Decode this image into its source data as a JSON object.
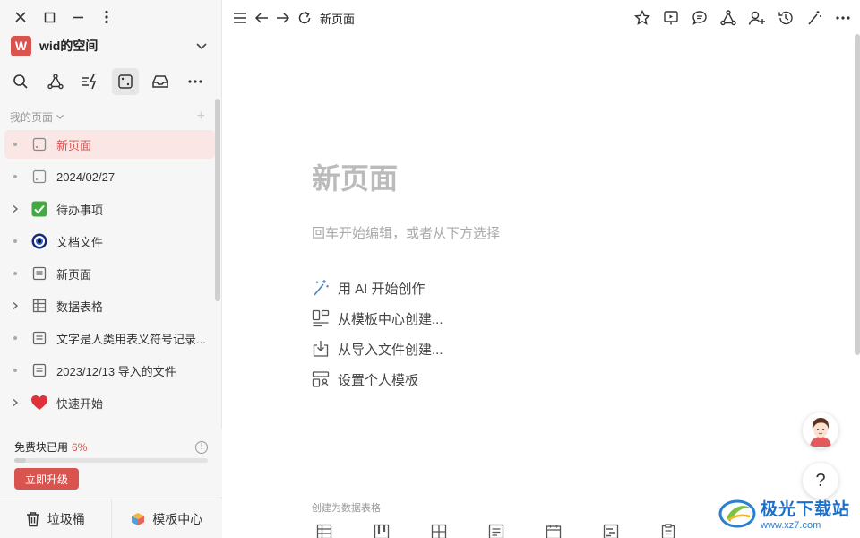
{
  "window": {
    "controls": [
      "close-icon",
      "maximize-icon",
      "minimize-icon",
      "more-vertical-icon"
    ]
  },
  "workspace": {
    "avatar_letter": "W",
    "name": "wid的空间",
    "accent": "#d9534f"
  },
  "toolbar": [
    "search-icon",
    "graph-icon",
    "automation-icon",
    "page-icon",
    "inbox-icon",
    "more-icon"
  ],
  "section": {
    "title": "我的页面",
    "add_label": "+"
  },
  "tree": [
    {
      "label": "新页面",
      "icon": "page-icon",
      "lead": "dot",
      "active": true
    },
    {
      "label": "2024/02/27",
      "icon": "page-icon",
      "lead": "dot"
    },
    {
      "label": "待办事项",
      "icon": "checkbox-icon",
      "lead": "chevron"
    },
    {
      "label": "文档文件",
      "icon": "eye-icon",
      "lead": "dot"
    },
    {
      "label": "新页面",
      "icon": "doc-icon",
      "lead": "dot"
    },
    {
      "label": "数据表格",
      "icon": "table-icon",
      "lead": "chevron"
    },
    {
      "label": "文字是人类用表义符号记录...",
      "icon": "doc-icon",
      "lead": "dot"
    },
    {
      "label": "2023/12/13 导入的文件",
      "icon": "doc-icon",
      "lead": "dot"
    },
    {
      "label": "快速开始",
      "icon": "heart-icon",
      "lead": "chevron"
    }
  ],
  "usage": {
    "label": "免费块已用",
    "percent_text": "6%",
    "percent": 0.06,
    "info": "!"
  },
  "upgrade_label": "立即升级",
  "bottom": {
    "trash_label": "垃圾桶",
    "templates_label": "模板中心"
  },
  "topbar": {
    "breadcrumb": "新页面"
  },
  "page": {
    "title": "新页面",
    "hint": "回车开始编辑，或者从下方选择",
    "actions": [
      {
        "label": "用 AI 开始创作",
        "icon": "ai-wand-icon"
      },
      {
        "label": "从模板中心创建...",
        "icon": "template-icon"
      },
      {
        "label": "从导入文件创建...",
        "icon": "import-icon"
      },
      {
        "label": "设置个人模板",
        "icon": "personal-template-icon"
      }
    ],
    "db_label": "创建为数据表格"
  },
  "help_label": "?",
  "watermark": {
    "main": "极光下载站",
    "sub": "www.xz7.com"
  }
}
